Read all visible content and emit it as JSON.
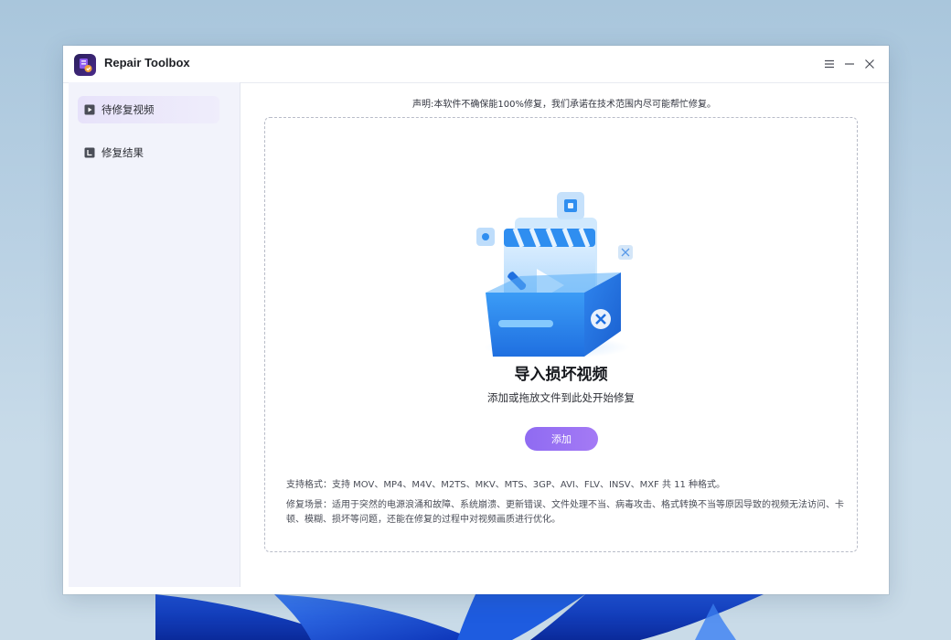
{
  "window": {
    "title": "Repair Toolbox",
    "controls": {
      "menu_icon": "menu-icon",
      "minimize_icon": "minimize-icon",
      "close_icon": "close-icon"
    }
  },
  "sidebar": {
    "items": [
      {
        "label": "待修复视频",
        "icon": "video-file-icon",
        "active": true
      },
      {
        "label": "修复结果",
        "icon": "result-file-icon",
        "active": false
      }
    ]
  },
  "main": {
    "disclaimer": "声明:本软件不确保能100%修复，我们承诺在技术范围内尽可能帮忙修复。",
    "drop_zone": {
      "title": "导入损坏视频",
      "subtitle": "添加或拖放文件到此处开始修复",
      "add_button": "添加",
      "illustration_icon": "video-repair-box-illustration"
    },
    "supported_formats": "支持格式：支持 MOV、MP4、M4V、M2TS、MKV、MTS、3GP、AVI、FLV、INSV、MXF 共 11 种格式。",
    "repair_scenarios": "修复场景：适用于突然的电源浪涌和故障、系统崩溃、更新错误、文件处理不当、病毒攻击、格式转换不当等原因导致的视频无法访问、卡顿、模糊、损坏等问题，还能在修复的过程中对视频画质进行优化。"
  },
  "colors": {
    "accent": "#9a72f4",
    "sidebar_bg": "#f2f3fb",
    "active_item_bg": "#e8e3fa",
    "illustration_blue": "#2f8ef0"
  }
}
